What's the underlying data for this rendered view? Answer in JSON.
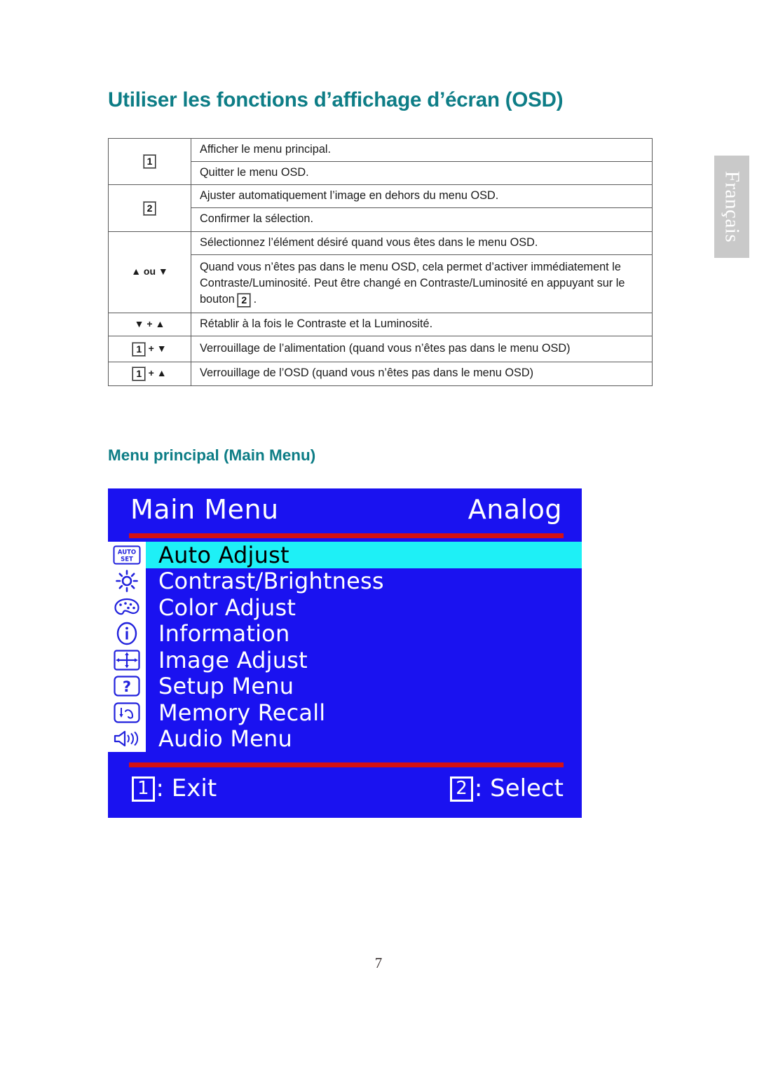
{
  "document": {
    "title": "Utiliser les fonctions d’affichage d’écran (OSD)",
    "subheading": "Menu principal (Main Menu)",
    "page_number": "7",
    "language_tab": "Français",
    "title_color": "#0d7d86",
    "tab_color": "#c9c9c9"
  },
  "key_table": {
    "rows": [
      {
        "key_parts": [
          "1"
        ],
        "key_text": "1",
        "desc": "Afficher le menu principal."
      },
      {
        "key_parts": [],
        "key_text": "",
        "desc": "Quitter le menu OSD."
      },
      {
        "key_parts": [
          "2"
        ],
        "key_text": "2",
        "desc": "Ajuster automatiquement l’image en dehors du menu OSD."
      },
      {
        "key_parts": [],
        "key_text": "",
        "desc": "Confirmer la sélection."
      },
      {
        "key_parts": [],
        "key_text": "▲ ou ▼",
        "desc": "Sélectionnez l’élément désiré quand vous êtes dans le menu OSD."
      },
      {
        "key_parts": [],
        "key_text": "",
        "desc_a": "Quand vous n’êtes pas dans le menu OSD, cela permet d’activer immédiatement le Contraste/Luminosité. Peut être changé en Contraste/Luminosité en appuyant sur le bouton ",
        "desc_b": "2",
        "desc_c": " ."
      },
      {
        "key_parts": [],
        "key_text": "▼ + ▲",
        "desc": "Rétablir à la fois le Contraste et la Luminosité."
      },
      {
        "key_parts": [
          "1"
        ],
        "key_text": "+ ▼",
        "desc": "Verrouillage de l’alimentation (quand vous n’êtes pas dans le menu OSD)"
      },
      {
        "key_parts": [
          "1"
        ],
        "key_text": "+ ▲",
        "desc": "Verrouillage de l’OSD (quand vous n’êtes pas dans le menu OSD)"
      }
    ],
    "labels": {
      "row1_key": "1",
      "row1_desc": "Afficher le menu principal.",
      "row2_desc": "Quitter le menu OSD.",
      "row3_key": "2",
      "row3_desc": "Ajuster automatiquement l’image en dehors du menu OSD.",
      "row4_desc": "Confirmer la sélection.",
      "row5_key": "▲ ou ▼",
      "row5_desc": "Sélectionnez l’élément désiré quand vous êtes dans le menu OSD.",
      "row6_desc_pre": "Quand vous n’êtes pas dans le menu OSD, cela permet d’activer immédiatement le Contraste/Luminosité. Peut être changé en Contraste/Luminosité en appuyant sur le bouton",
      "row6_btn": "2",
      "row6_desc_post": ".",
      "row7_key": "▼ + ▲",
      "row7_desc": "Rétablir à la fois le Contraste et la Luminosité.",
      "row8_btn": "1",
      "row8_key_rest": "+ ▼",
      "row8_desc": "Verrouillage de l’alimentation (quand vous n’êtes pas dans le menu OSD)",
      "row9_btn": "1",
      "row9_key_rest": "+ ▲",
      "row9_desc": "Verrouillage de l’OSD (quand vous n’êtes pas dans le menu OSD)"
    }
  },
  "osd": {
    "title": "Main Menu",
    "source": "Analog",
    "background_color": "#1a12f0",
    "rule_color": "#d51014",
    "highlight_color": "#1ef0f6",
    "items": [
      {
        "label": "Auto Adjust",
        "icon": "auto-set-icon",
        "selected": true
      },
      {
        "label": "Contrast/Brightness",
        "icon": "brightness-sun-icon",
        "selected": false
      },
      {
        "label": "Color Adjust",
        "icon": "color-palette-icon",
        "selected": false
      },
      {
        "label": "Information",
        "icon": "info-circle-icon",
        "selected": false
      },
      {
        "label": "Image Adjust",
        "icon": "image-arrows-icon",
        "selected": false
      },
      {
        "label": "Setup Menu",
        "icon": "question-mark-icon",
        "selected": false
      },
      {
        "label": "Memory Recall",
        "icon": "memory-recall-icon",
        "selected": false
      },
      {
        "label": "Audio Menu",
        "icon": "speaker-icon",
        "selected": false
      }
    ],
    "auto_icon_line1": "AUTO",
    "auto_icon_line2": "SET",
    "footer": {
      "exit_key": "1",
      "exit_label": ": Exit",
      "select_key": "2",
      "select_label": ": Select"
    }
  }
}
